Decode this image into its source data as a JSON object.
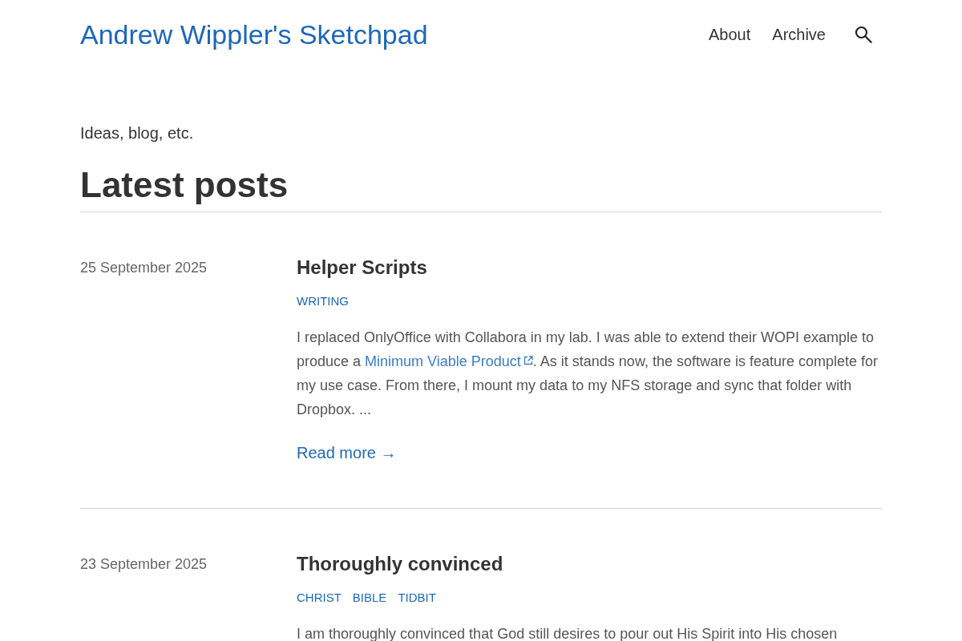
{
  "site": {
    "title": "Andrew Wippler's Sketchpad"
  },
  "nav": [
    {
      "label": "About"
    },
    {
      "label": "Archive"
    }
  ],
  "tagline": "Ideas, blog, etc.",
  "section_title": "Latest posts",
  "posts": [
    {
      "date": "25 September 2025",
      "title": "Helper Scripts",
      "tags": [
        "WRITING"
      ],
      "summary": [
        {
          "kind": "text",
          "text": "I replaced OnlyOffice with Collabora in my lab. I was able to extend their WOPI example to produce a "
        },
        {
          "kind": "link",
          "text": "Minimum Viable Product"
        },
        {
          "kind": "text",
          "text": ". As it stands now, the software is feature complete for my use case. From there, I mount my data to my NFS storage and sync that folder with Dropbox. ..."
        }
      ],
      "read_more": "Read more →"
    },
    {
      "date": "23 September 2025",
      "title": "Thoroughly convinced",
      "tags": [
        "CHRIST",
        "BIBLE",
        "TIDBIT"
      ],
      "summary": [
        {
          "kind": "text",
          "text": "I am thoroughly convinced that God still desires to pour out His Spirit into His chosen"
        }
      ]
    }
  ]
}
